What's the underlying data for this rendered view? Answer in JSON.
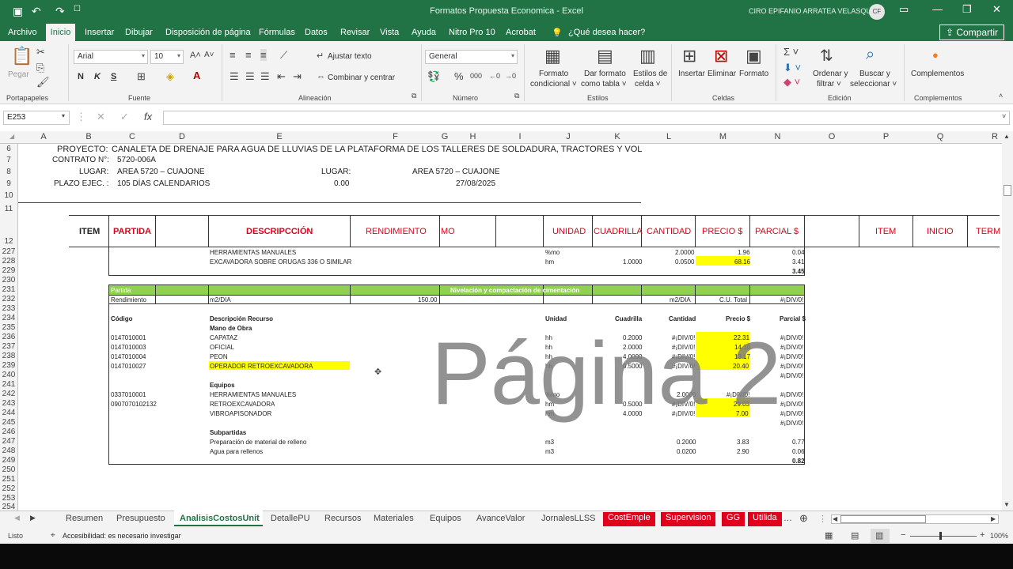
{
  "titlebar": {
    "doc_title": "Formatos Propuesta Economica  -  Excel",
    "user": "CIRO EPIFANIO ARRATEA VELASQUEZ",
    "avatar": "CF"
  },
  "menu": [
    "Archivo",
    "Inicio",
    "Insertar",
    "Dibujar",
    "Disposición de página",
    "Fórmulas",
    "Datos",
    "Revisar",
    "Vista",
    "Ayuda",
    "Nitro Pro 10",
    "Acrobat"
  ],
  "tell_me": "¿Qué desea hacer?",
  "share": "Compartir",
  "ribbon": {
    "paste": "Pegar",
    "clipboard": "Portapapeles",
    "font": "Arial",
    "size": "10",
    "font_group": "Fuente",
    "bold": "N",
    "italic": "K",
    "underline": "S",
    "wrap": "Ajustar texto",
    "merge": "Combinar y centrar",
    "align_group": "Alineación",
    "numformat": "General",
    "number_group": "Número",
    "cond_format": "Formato condicional",
    "table_format": "Dar formato como tabla",
    "cell_styles": "Estilos de celda",
    "styles_group": "Estilos",
    "insert": "Insertar",
    "delete": "Eliminar",
    "format": "Formato",
    "cells_group": "Celdas",
    "sort": "Ordenar y filtrar",
    "find": "Buscar y seleccionar",
    "editing_group": "Edición",
    "addins": "Complementos",
    "addins_group": "Complementos"
  },
  "namebox": "E253",
  "columns": [
    "A",
    "B",
    "C",
    "D",
    "E",
    "F",
    "G",
    "H",
    "I",
    "J",
    "K",
    "L",
    "M",
    "N",
    "O",
    "P",
    "Q",
    "R"
  ],
  "rows": [
    "6",
    "7",
    "8",
    "9",
    "10",
    "11",
    "12",
    "227",
    "228",
    "229",
    "230",
    "231",
    "232",
    "233",
    "234",
    "235",
    "236",
    "237",
    "238",
    "239",
    "240",
    "241",
    "242",
    "243",
    "244",
    "245",
    "246",
    "247",
    "248",
    "249",
    "250",
    "251",
    "252",
    "253",
    "254"
  ],
  "header": {
    "proyecto_label": "PROYECTO:",
    "proyecto": "CANALETA DE DRENAJE PARA AGUA DE LLUVIAS DE LA PLATAFORMA DE LOS TALLERES DE SOLDADURA, TRACTORES Y VOL",
    "contrato_label": "CONTRATO N°:",
    "contrato": "5720-006A",
    "lugar_label": "LUGAR:",
    "lugar": "AREA 5720 – CUAJONE",
    "lugar2_label": "LUGAR:",
    "lugar2": "AREA 5720 – CUAJONE",
    "plazo_label": "PLAZO EJEC. :",
    "plazo": "105 DÍAS CALENDARIOS",
    "plazo_val": "0.00",
    "fecha": "27/08/2025"
  },
  "table_header": [
    "ITEM",
    "PARTIDA",
    "DESCRIPCCIÓN",
    "RENDIMIENTO",
    "MO",
    "UNIDAD",
    "CUADRILLA",
    "CANTIDAD",
    "PRECIO $",
    "PARCIAL $",
    "ITEM",
    "INICIO",
    "TERM"
  ],
  "prev": {
    "r227": {
      "desc": "HERRAMIENTAS MANUALES",
      "unit": "%mo",
      "cant": "2.0000",
      "precio": "1.96",
      "parcial": "0.04"
    },
    "r228": {
      "desc": "EXCAVADORA SOBRE ORUGAS 336 O SIMILAR",
      "unit": "hm",
      "cuad": "1.0000",
      "cant": "0.0500",
      "precio": "68.16",
      "parcial": "3.41"
    },
    "r229": {
      "total": "3.45"
    }
  },
  "block": {
    "partida_label": "Partida",
    "partida_name": "Nivelación y compactación de cimentación",
    "rend_label": "Rendimiento",
    "rend_unit": "m2/DIA",
    "rend_val": "150.00",
    "rend_unit2": "m2/DIA",
    "cu_total": "C.U. Total",
    "cu_val": "#¡DIV/0!",
    "col_codigo": "Código",
    "col_desc": "Descripción Recurso",
    "col_unidad": "Unidad",
    "col_cuad": "Cuadrilla",
    "col_cant": "Cantidad",
    "col_precio": "Precio $",
    "col_parcial": "Parcial $",
    "mano": "Mano de Obra",
    "equipos": "Equipos",
    "subpartidas": "Subpartidas",
    "lines": [
      {
        "row": 236,
        "code": "0147010001",
        "desc": "CAPATAZ",
        "unit": "hh",
        "cuad": "0.2000",
        "cant": "#¡DIV/0!",
        "precio": "22.31",
        "parcial": "#¡DIV/0!"
      },
      {
        "row": 237,
        "code": "0147010003",
        "desc": "OFICIAL",
        "unit": "hh",
        "cuad": "2.0000",
        "cant": "#¡DIV/0!",
        "precio": "14.10",
        "parcial": "#¡DIV/0!"
      },
      {
        "row": 238,
        "code": "0147010004",
        "desc": "PEON",
        "unit": "hh",
        "cuad": "4.0000",
        "cant": "#¡DIV/0!",
        "precio": "13.17",
        "parcial": "#¡DIV/0!"
      },
      {
        "row": 239,
        "code": "0147010027",
        "desc": "OPERADOR RETROEXCAVADORA",
        "unit": "hh",
        "cuad": "0.5000",
        "cant": "#¡DIV/0!",
        "precio": "20.40",
        "parcial": "#¡DIV/0!"
      },
      {
        "row": 242,
        "code": "0337010001",
        "desc": "HERRAMIENTAS MANUALES",
        "unit": "%mo",
        "cuad": "",
        "cant": "2.0000",
        "precio": "#¡DIV/0!",
        "parcial": "#¡DIV/0!"
      },
      {
        "row": 243,
        "code": "0907070102132",
        "desc": "RETROEXCAVADORA",
        "unit": "hm",
        "cuad": "0.5000",
        "cant": "#¡DIV/0!",
        "precio": "29.03",
        "parcial": "#¡DIV/0!"
      },
      {
        "row": 244,
        "code": "",
        "desc": "VIBROAPISONADOR",
        "unit": "hm",
        "cuad": "4.0000",
        "cant": "#¡DIV/0!",
        "precio": "7.00",
        "parcial": "#¡DIV/0!"
      },
      {
        "row": 247,
        "code": "",
        "desc": "Preparación de material de relleno",
        "unit": "m3",
        "cuad": "",
        "cant": "0.2000",
        "precio": "3.83",
        "parcial": "0.77"
      },
      {
        "row": 248,
        "code": "",
        "desc": "Agua para rellenos",
        "unit": "m3",
        "cuad": "",
        "cant": "0.0200",
        "precio": "2.90",
        "parcial": "0.06"
      }
    ],
    "sub240": "#¡DIV/0!",
    "sub245": "#¡DIV/0!",
    "sub249": "0.82"
  },
  "watermark": "Página 2",
  "sheets": [
    "Resumen",
    "Presupuesto",
    "AnalisisCostosUnit",
    "DetallePU",
    "Recursos",
    "Materiales",
    "Equipos",
    "AvanceValor",
    "JornalesLLSS"
  ],
  "red_sheets": [
    "CostEmple",
    "Supervision",
    "GG",
    "Utilida"
  ],
  "status": {
    "ready": "Listo",
    "accessibility": "Accesibilidad: es necesario investigar",
    "zoom": "100%"
  }
}
